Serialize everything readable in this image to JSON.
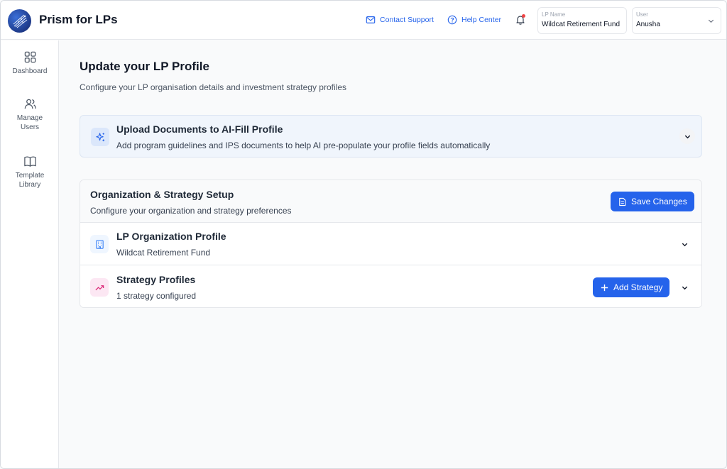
{
  "app": {
    "title": "Prism for LPs"
  },
  "header": {
    "contact_support": "Contact Support",
    "help_center": "Help Center",
    "lp_name_label": "LP Name",
    "lp_name_value": "Wildcat Retirement Fund",
    "user_label": "User",
    "user_value": "Anusha"
  },
  "sidebar": {
    "items": [
      {
        "label": "Dashboard",
        "icon": "grid-icon"
      },
      {
        "label": "Manage Users",
        "icon": "users-icon"
      },
      {
        "label": "Template Library",
        "icon": "book-icon"
      }
    ]
  },
  "main": {
    "title": "Update your LP Profile",
    "subtitle": "Configure your LP organisation details and investment strategy profiles",
    "upload": {
      "title": "Upload Documents to AI-Fill Profile",
      "subtitle": "Add program guidelines and IPS documents to help AI pre-populate your profile fields automatically"
    },
    "setup": {
      "title": "Organization & Strategy Setup",
      "subtitle": "Configure your organization and strategy preferences",
      "save_label": "Save Changes",
      "org": {
        "title": "LP Organization Profile",
        "subtitle": "Wildcat Retirement Fund"
      },
      "strategy": {
        "title": "Strategy Profiles",
        "subtitle": "1 strategy configured",
        "add_label": "Add Strategy"
      }
    }
  },
  "colors": {
    "accent": "#2563eb",
    "notification": "#ef4444",
    "strategy_tile": "#fce7f3",
    "org_tile": "#eff6ff"
  }
}
